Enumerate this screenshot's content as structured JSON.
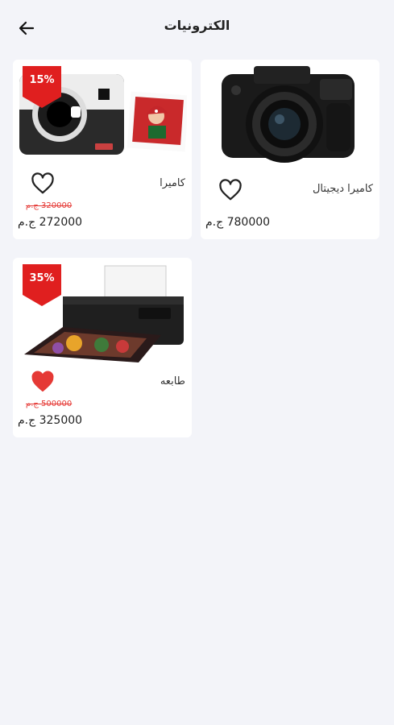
{
  "header": {
    "title": "الكترونيات",
    "back_icon": "arrow-left-icon"
  },
  "products": [
    {
      "name": "كاميرا ديجيتال",
      "price": "780000 ج.م",
      "favorite": false
    },
    {
      "name": "كاميرا",
      "price": "272000 ج.م",
      "old_price": "320000 ج.م",
      "discount": "15%",
      "favorite": false
    },
    {
      "name": "طابعه",
      "price": "325000 ج.م",
      "old_price": "500000 ج.م",
      "discount": "35%",
      "favorite": true
    }
  ],
  "colors": {
    "accent_red": "#e53935",
    "background": "#f3f4f9",
    "card": "#ffffff"
  }
}
